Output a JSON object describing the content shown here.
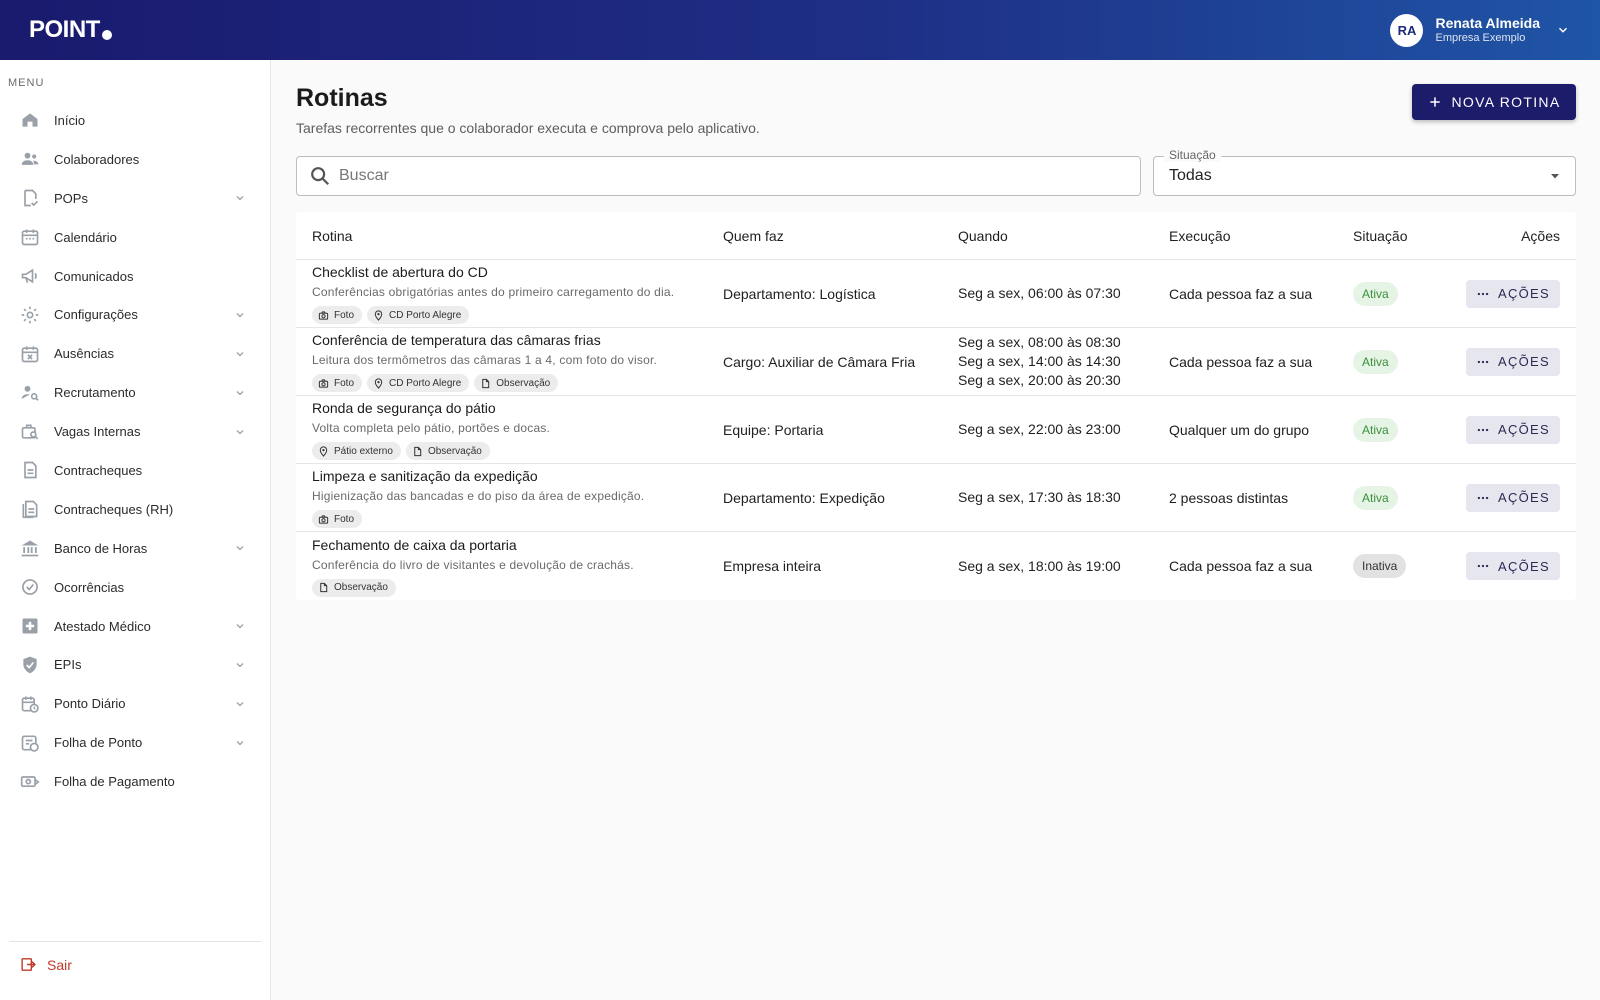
{
  "header": {
    "logo_text": "POINT",
    "user_initials": "RA",
    "user_name": "Renata Almeida",
    "user_company": "Empresa Exemplo"
  },
  "sidebar": {
    "menu_title": "MENU",
    "items": [
      {
        "label": "Início",
        "icon": "home-icon",
        "has_caret": false
      },
      {
        "label": "Colaboradores",
        "icon": "people-icon",
        "has_caret": false
      },
      {
        "label": "POPs",
        "icon": "document-check-icon",
        "has_caret": true
      },
      {
        "label": "Calendário",
        "icon": "calendar-icon",
        "has_caret": false
      },
      {
        "label": "Comunicados",
        "icon": "megaphone-icon",
        "has_caret": false
      },
      {
        "label": "Configurações",
        "icon": "gear-icon",
        "has_caret": true
      },
      {
        "label": "Ausências",
        "icon": "calendar-x-icon",
        "has_caret": true
      },
      {
        "label": "Recrutamento",
        "icon": "person-search-icon",
        "has_caret": true
      },
      {
        "label": "Vagas Internas",
        "icon": "job-search-icon",
        "has_caret": true
      },
      {
        "label": "Contracheques",
        "icon": "payslip-icon",
        "has_caret": false
      },
      {
        "label": "Contracheques (RH)",
        "icon": "payslip-stack-icon",
        "has_caret": false
      },
      {
        "label": "Banco de Horas",
        "icon": "bank-icon",
        "has_caret": true
      },
      {
        "label": "Ocorrências",
        "icon": "occurrence-icon",
        "has_caret": false
      },
      {
        "label": "Atestado Médico",
        "icon": "medical-cross-icon",
        "has_caret": true
      },
      {
        "label": "EPIs",
        "icon": "shield-check-icon",
        "has_caret": true
      },
      {
        "label": "Ponto Diário",
        "icon": "calendar-clock-icon",
        "has_caret": true
      },
      {
        "label": "Folha de Ponto",
        "icon": "timesheet-icon",
        "has_caret": true
      },
      {
        "label": "Folha de Pagamento",
        "icon": "payment-icon",
        "has_caret": false
      }
    ],
    "logout_label": "Sair"
  },
  "main": {
    "title": "Rotinas",
    "subtitle": "Tarefas recorrentes que o colaborador executa e comprova pelo aplicativo.",
    "new_button_label": "NOVA ROTINA",
    "search_placeholder": "Buscar",
    "filter_label": "Situação",
    "filter_value": "Todas",
    "actions_label": "AÇÕES",
    "columns": [
      "Rotina",
      "Quem faz",
      "Quando",
      "Execução",
      "Situação",
      "Ações"
    ],
    "rows": [
      {
        "name": "Checklist de abertura do CD",
        "desc": "Conferências obrigatórias antes do primeiro carregamento do dia.",
        "chips": [
          {
            "icon": "camera-icon",
            "label": "Foto"
          },
          {
            "icon": "location-pin-icon",
            "label": "CD Porto Alegre"
          }
        ],
        "who": "Departamento: Logística",
        "when": [
          "Seg a sex, 06:00 às 07:30"
        ],
        "execution": "Cada pessoa faz a sua",
        "status": "Ativa"
      },
      {
        "name": "Conferência de temperatura das câmaras frias",
        "desc": "Leitura dos termômetros das câmaras 1 a 4, com foto do visor.",
        "chips": [
          {
            "icon": "camera-icon",
            "label": "Foto"
          },
          {
            "icon": "location-pin-icon",
            "label": "CD Porto Alegre"
          },
          {
            "icon": "note-icon",
            "label": "Observação"
          }
        ],
        "who": "Cargo: Auxiliar de Câmara Fria",
        "when": [
          "Seg a sex, 08:00 às 08:30",
          "Seg a sex, 14:00 às 14:30",
          "Seg a sex, 20:00 às 20:30"
        ],
        "execution": "Cada pessoa faz a sua",
        "status": "Ativa"
      },
      {
        "name": "Ronda de segurança do pátio",
        "desc": "Volta completa pelo pátio, portões e docas.",
        "chips": [
          {
            "icon": "location-pin-icon",
            "label": "Pátio externo"
          },
          {
            "icon": "note-icon",
            "label": "Observação"
          }
        ],
        "who": "Equipe: Portaria",
        "when": [
          "Seg a sex, 22:00 às 23:00"
        ],
        "execution": "Qualquer um do grupo",
        "status": "Ativa"
      },
      {
        "name": "Limpeza e sanitização da expedição",
        "desc": "Higienização das bancadas e do piso da área de expedição.",
        "chips": [
          {
            "icon": "camera-icon",
            "label": "Foto"
          }
        ],
        "who": "Departamento: Expedição",
        "when": [
          "Seg a sex, 17:30 às 18:30"
        ],
        "execution": "2 pessoas distintas",
        "status": "Ativa"
      },
      {
        "name": "Fechamento de caixa da portaria",
        "desc": "Conferência do livro de visitantes e devolução de crachás.",
        "chips": [
          {
            "icon": "note-icon",
            "label": "Observação"
          }
        ],
        "who": "Empresa inteira",
        "when": [
          "Seg a sex, 18:00 às 19:00"
        ],
        "execution": "Cada pessoa faz a sua",
        "status": "Inativa"
      }
    ]
  },
  "colors": {
    "header_start": "#1a1a6e",
    "header_end": "#1f55a6",
    "primary_button": "#1c1c6b",
    "active_badge_bg": "#e6f4e6",
    "active_badge_text": "#3a8f3e",
    "logout": "#c0392b"
  }
}
